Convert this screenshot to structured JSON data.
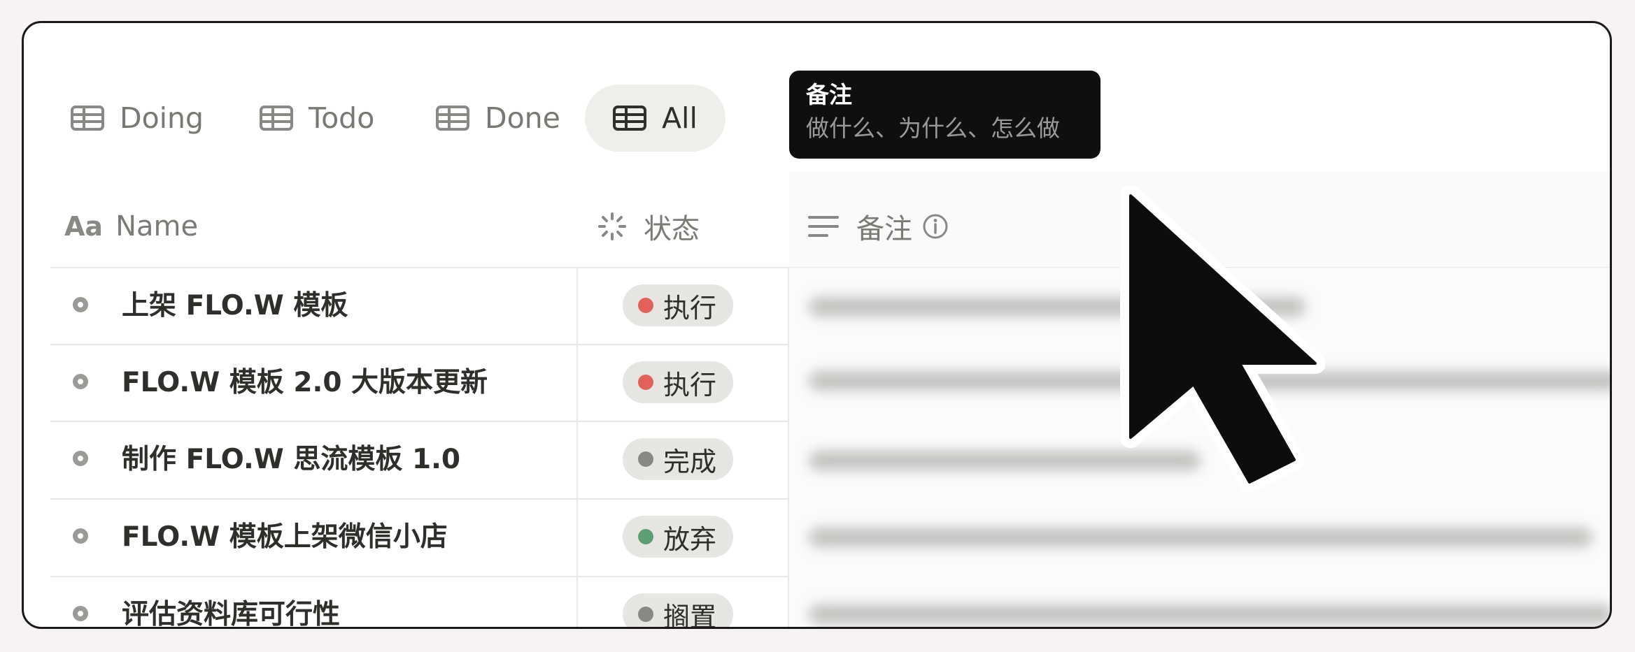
{
  "tabs": [
    {
      "label": "Doing",
      "active": false
    },
    {
      "label": "Todo",
      "active": false
    },
    {
      "label": "Done",
      "active": false
    },
    {
      "label": "All",
      "active": true
    }
  ],
  "tooltip": {
    "title": "备注",
    "subtitle": "做什么、为什么、怎么做"
  },
  "columns": {
    "name": "Name",
    "name_icon": "Aa",
    "status": "状态",
    "notes": "备注"
  },
  "rows": [
    {
      "name": "上架 FLO.W 模板",
      "status": "执行",
      "status_color": "#e16259"
    },
    {
      "name": "FLO.W 模板 2.0 大版本更新",
      "status": "执行",
      "status_color": "#e16259"
    },
    {
      "name": "制作 FLO.W 思流模板 1.0",
      "status": "完成",
      "status_color": "#8a8884"
    },
    {
      "name": "FLO.W 模板上架微信小店",
      "status": "放弃",
      "status_color": "#5e9e73"
    },
    {
      "name": "评估资料库可行性",
      "status": "搁置",
      "status_color": "#8a8884"
    }
  ],
  "icons": {
    "tab": "table-icon",
    "name_column": "text-type-icon",
    "status_column": "status-spinner-icon",
    "notes_column": "lines-icon",
    "info": "info-icon",
    "row": "circle-icon",
    "pointer": "mouse-pointer-icon"
  }
}
